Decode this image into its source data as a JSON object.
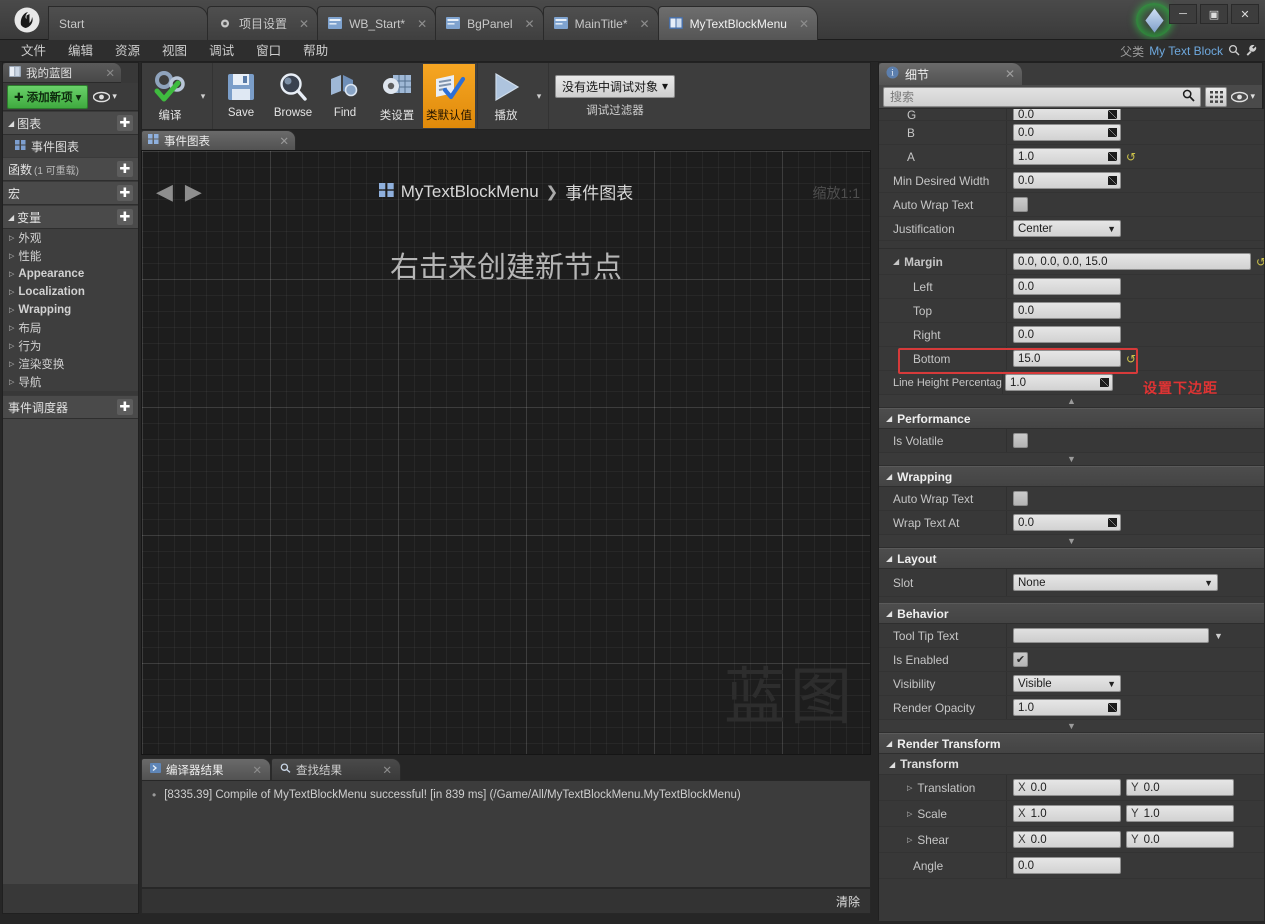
{
  "window": {
    "logo": "ue-logo",
    "minimize": "─",
    "maximize": "▣",
    "close": "✕"
  },
  "tabs": [
    {
      "label": "Start",
      "icon": "",
      "close": "",
      "active": false
    },
    {
      "label": "项目设置",
      "icon": "gear-icon",
      "close": "✕",
      "active": false
    },
    {
      "label": "WB_Start*",
      "icon": "widget-icon",
      "close": "✕",
      "active": false
    },
    {
      "label": "BgPanel",
      "icon": "widget-icon",
      "close": "✕",
      "active": false
    },
    {
      "label": "MainTitle*",
      "icon": "widget-icon",
      "close": "✕",
      "active": false
    },
    {
      "label": "MyTextBlockMenu",
      "icon": "blueprint-icon",
      "close": "✕",
      "active": true
    }
  ],
  "menu": {
    "items": [
      "文件",
      "编辑",
      "资源",
      "视图",
      "调试",
      "窗口",
      "帮助"
    ]
  },
  "parent_class": {
    "label": "父类",
    "value": "My Text Block",
    "search_icon": "search-icon",
    "wrench_icon": "wrench-icon"
  },
  "my_blueprint": {
    "tab_title": "我的蓝图",
    "tab_close": "✕",
    "add_new": "添加新项",
    "add_new_plus": "✚",
    "add_new_caret": "▾",
    "eye_icon": "eye-icon",
    "sections": [
      {
        "name": "图表",
        "caret": "◢",
        "plus": "✚",
        "sub": ""
      },
      {
        "name": "函数",
        "caret": "",
        "plus": "✚",
        "sub": "(1 可重载)"
      },
      {
        "name": "宏",
        "caret": "",
        "plus": "✚",
        "sub": ""
      },
      {
        "name": "变量",
        "caret": "◢",
        "plus": "✚",
        "sub": ""
      },
      {
        "name": "事件调度器",
        "caret": "",
        "plus": "✚",
        "sub": ""
      }
    ],
    "graph_item": "事件图表",
    "variable_groups": [
      {
        "label": "外观",
        "bold": false
      },
      {
        "label": "性能",
        "bold": false
      },
      {
        "label": "Appearance",
        "bold": true
      },
      {
        "label": "Localization",
        "bold": true
      },
      {
        "label": "Wrapping",
        "bold": true
      },
      {
        "label": "布局",
        "bold": false
      },
      {
        "label": "行为",
        "bold": false
      },
      {
        "label": "渲染变换",
        "bold": false
      },
      {
        "label": "导航",
        "bold": false
      }
    ]
  },
  "toolbar": {
    "buttons": [
      {
        "label": "编译",
        "icon": "compile-icon",
        "active": false,
        "dropdown": true
      },
      {
        "label": "Save",
        "icon": "save-icon",
        "active": false,
        "dropdown": false
      },
      {
        "label": "Browse",
        "icon": "browse-icon",
        "active": false,
        "dropdown": false
      },
      {
        "label": "Find",
        "icon": "find-icon",
        "active": false,
        "dropdown": false
      },
      {
        "label": "类设置",
        "icon": "class-settings-icon",
        "active": false,
        "dropdown": false
      },
      {
        "label": "类默认值",
        "icon": "class-defaults-icon",
        "active": true,
        "dropdown": false
      },
      {
        "label": "播放",
        "icon": "play-icon",
        "active": false,
        "dropdown": true
      }
    ],
    "debug_object": "没有选中调试对象",
    "debug_caret": "▾",
    "debug_filter_label": "调试过滤器"
  },
  "graph": {
    "tab_label": "事件图表",
    "tab_close": "✕",
    "tab_icon": "graph-icon",
    "back_arrow": "◀",
    "forward_arrow": "▶",
    "breadcrumb_root": "MyTextBlockMenu",
    "breadcrumb_sep": "❯",
    "breadcrumb_leaf": "事件图表",
    "breadcrumb_icon": "graph-icon",
    "zoom_label": "缩放1:1",
    "hint": "右击来创建新节点",
    "watermark": "蓝图"
  },
  "results": {
    "tabs": [
      {
        "label": "编译器结果",
        "icon": "compiler-icon",
        "close": "✕",
        "active": true
      },
      {
        "label": "查找结果",
        "icon": "search-icon",
        "close": "✕",
        "active": false
      }
    ],
    "messages": [
      {
        "bullet": "•",
        "text": "[8335.39] Compile of MyTextBlockMenu successful! [in 839 ms] (/Game/All/MyTextBlockMenu.MyTextBlockMenu)"
      }
    ],
    "clear_label": "清除"
  },
  "details": {
    "tab_title": "细节",
    "tab_close": "✕",
    "tab_icon": "details-icon",
    "search_placeholder": "搜索",
    "search_icon": "search-icon",
    "grid_icon": "grid-view-icon",
    "eye_icon": "eye-icon",
    "eye_caret": "▾",
    "rows_top": [
      {
        "label": "G",
        "value": "0.0",
        "type": "number",
        "clipped": true
      },
      {
        "label": "B",
        "value": "0.0",
        "type": "number",
        "revert": false
      },
      {
        "label": "A",
        "value": "1.0",
        "type": "number",
        "revert": true
      },
      {
        "label": "Min Desired Width",
        "value": "0.0",
        "type": "number",
        "revert": false
      },
      {
        "label": "Auto Wrap Text",
        "value": "",
        "type": "checkbox",
        "checked": false
      },
      {
        "label": "Justification",
        "value": "Center",
        "type": "combo"
      }
    ],
    "margin": {
      "label": "Margin",
      "summary": "0.0, 0.0, 0.0, 15.0",
      "revert": true,
      "fields": [
        {
          "label": "Left",
          "value": "0.0"
        },
        {
          "label": "Top",
          "value": "0.0"
        },
        {
          "label": "Right",
          "value": "0.0"
        },
        {
          "label": "Bottom",
          "value": "15.0",
          "highlighted": true,
          "revert": true
        }
      ]
    },
    "line_height": {
      "label": "Line Height Percentag",
      "value": "1.0"
    },
    "annotation": "设置下边距",
    "annotation_color": "#e03333",
    "highlight_color": "#d63a3a",
    "performance": {
      "header": "Performance",
      "rows": [
        {
          "label": "Is Volatile",
          "type": "checkbox",
          "checked": false
        }
      ]
    },
    "wrapping": {
      "header": "Wrapping",
      "rows": [
        {
          "label": "Auto Wrap Text",
          "type": "checkbox",
          "checked": false
        },
        {
          "label": "Wrap Text At",
          "type": "number",
          "value": "0.0"
        }
      ]
    },
    "layout": {
      "header": "Layout",
      "rows": [
        {
          "label": "Slot",
          "type": "combo-wide",
          "value": "None"
        }
      ]
    },
    "behavior": {
      "header": "Behavior",
      "rows": [
        {
          "label": "Tool Tip Text",
          "type": "textbox",
          "value": ""
        },
        {
          "label": "Is Enabled",
          "type": "checkbox",
          "checked": true,
          "check": "✔"
        },
        {
          "label": "Visibility",
          "type": "combo",
          "value": "Visible"
        },
        {
          "label": "Render Opacity",
          "type": "number",
          "value": "1.0"
        }
      ]
    },
    "render_transform": {
      "header": "Render Transform",
      "sub_header": "Transform",
      "rows": [
        {
          "label": "Translation",
          "x": "0.0",
          "y": "0.0",
          "expandable": true
        },
        {
          "label": "Scale",
          "x": "1.0",
          "y": "1.0",
          "expandable": true
        },
        {
          "label": "Shear",
          "x": "0.0",
          "y": "0.0",
          "expandable": true
        },
        {
          "label": "Angle",
          "x": "0.0",
          "y": null,
          "expandable": false
        }
      ],
      "axis_x": "X",
      "axis_y": "Y"
    },
    "collapse_arrow": "▲",
    "expand_arrow": "▼"
  }
}
